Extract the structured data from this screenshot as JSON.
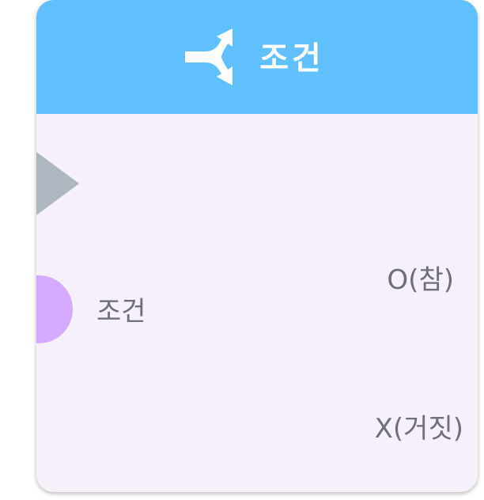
{
  "node": {
    "title": "조건",
    "icon": "branch-split-icon",
    "header_color": "#5fc0fd",
    "body_color": "#f5f0f9"
  },
  "ports": {
    "exec_in": {
      "color": "#aeb6c0"
    },
    "condition_in": {
      "label": "조건",
      "color": "#d6aaff"
    },
    "true_out": {
      "label": "O(참)"
    },
    "false_out": {
      "label": "X(거짓)"
    }
  }
}
